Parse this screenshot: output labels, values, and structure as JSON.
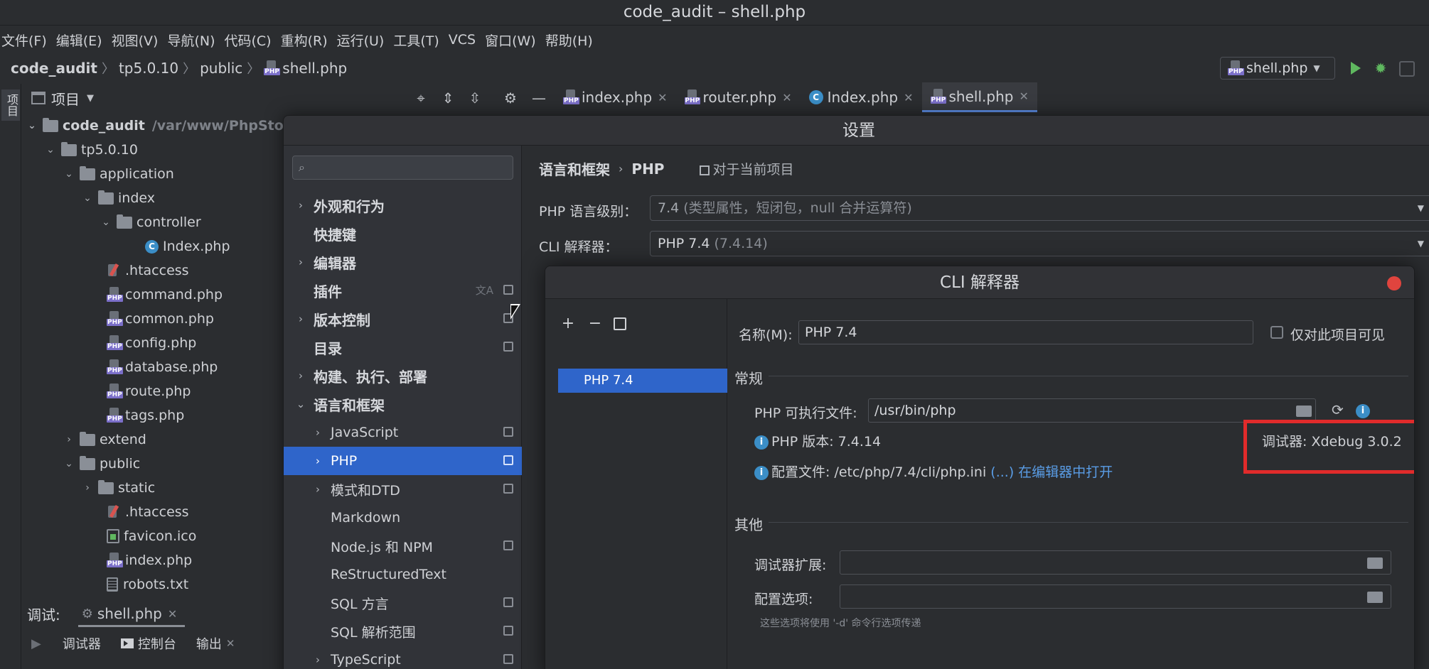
{
  "window": {
    "title": "code_audit – shell.php"
  },
  "menu": [
    "文件(F)",
    "编辑(E)",
    "视图(V)",
    "导航(N)",
    "代码(C)",
    "重构(R)",
    "运行(U)",
    "工具(T)",
    "VCS",
    "窗口(W)",
    "帮助(H)"
  ],
  "nav": {
    "crumbs": [
      "code_audit",
      "tp5.0.10",
      "public",
      "shell.php"
    ]
  },
  "run_config": {
    "label": "shell.php"
  },
  "sidebar_strip": {
    "label": "项目"
  },
  "project": {
    "title": "项目",
    "root": {
      "name": "code_audit",
      "path": "/var/www/PhpStorm"
    },
    "rows": [
      "tp5.0.10",
      "application",
      "index",
      "controller",
      "Index.php",
      ".htaccess",
      "command.php",
      "common.php",
      "config.php",
      "database.php",
      "route.php",
      "tags.php",
      "extend",
      "public",
      "static",
      ".htaccess",
      "favicon.ico",
      "index.php",
      "robots.txt"
    ]
  },
  "editor_tabs": [
    "index.php",
    "router.php",
    "Index.php",
    "shell.php"
  ],
  "debug": {
    "label": "调试:",
    "session": "shell.php",
    "tabs": [
      "调试器",
      "控制台",
      "输出"
    ]
  },
  "settings": {
    "title": "设置",
    "search": {
      "placeholder": ""
    },
    "nav": [
      "外观和行为",
      "快捷键",
      "编辑器",
      "插件",
      "版本控制",
      "目录",
      "构建、执行、部署",
      "语言和框架",
      "JavaScript",
      "PHP",
      "模式和DTD",
      "Markdown",
      "Node.js 和 NPM",
      "ReStructuredText",
      "SQL 方言",
      "SQL 解析范围",
      "TypeScript"
    ],
    "breadcrumb": {
      "parent": "语言和框架",
      "current": "PHP",
      "scope": "对于当前项目"
    },
    "php_level": {
      "label": "PHP 语言级别：",
      "value": "7.4",
      "detail": "(类型属性，短闭包，null 合并运算符)"
    },
    "cli": {
      "label": "CLI 解释器：",
      "value": "PHP 7.4",
      "detail": "(7.4.14)"
    }
  },
  "cli_dialog": {
    "title": "CLI 解释器",
    "toolbar": {
      "add": "+",
      "remove": "−"
    },
    "items": [
      "PHP 7.4"
    ],
    "name_label": "名称(M):",
    "name_value": "PHP 7.4",
    "visible_only_label": "仅对此项目可见",
    "general_section": "常规",
    "executable_label": "PHP 可执行文件:",
    "executable_value": "/usr/bin/php",
    "version_text": "PHP 版本: 7.4.14",
    "debugger_text": "调试器: Xdebug 3.0.2",
    "config_text": "配置文件: /etc/php/7.4/cli/php.ini",
    "config_link_dots": "(...)",
    "config_link_open": "在编辑器中打开",
    "other_section": "其他",
    "debugger_ext_label": "调试器扩展:",
    "config_options_label": "配置选项:",
    "hint": "这些选项将使用 '-d' 命令行选项传递"
  },
  "colors": {
    "accent": "#2f65ca",
    "highlight": "#e12b2b",
    "link": "#5a9de6",
    "run": "#5fb85f"
  }
}
